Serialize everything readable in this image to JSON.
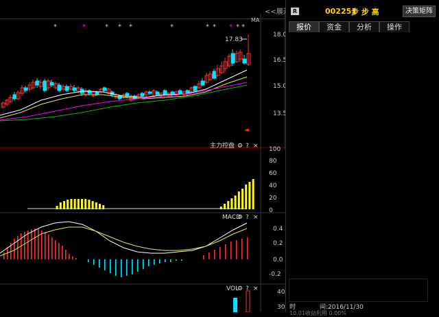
{
  "toolbar": {
    "expand_label": "展开",
    "expand_glyph": "<<",
    "decision_label": "决策矩阵"
  },
  "stock": {
    "badge": "R",
    "code": "002251",
    "name": "步 步 高"
  },
  "tabs": [
    {
      "label": "报价",
      "active": true
    },
    {
      "label": "资金",
      "active": false
    },
    {
      "label": "分析",
      "active": false
    },
    {
      "label": "操作",
      "active": false
    }
  ],
  "main_chart": {
    "label": "MA",
    "high_marker": "17.83",
    "star_marks": [
      "*",
      "*",
      "*",
      "*",
      "*",
      "*",
      "*",
      "*",
      "*",
      "*",
      "*"
    ],
    "price_axis": [
      "18.0",
      "16.5",
      "15.0",
      "13.5"
    ]
  },
  "panels": {
    "zhuli": {
      "title": "主力控盘",
      "gear": "⚙",
      "help": "?",
      "close": "×",
      "axis": [
        "100",
        "80",
        "60",
        "40",
        "20",
        "0"
      ]
    },
    "macd": {
      "title": "MACD",
      "gear": "⚙",
      "help": "?",
      "close": "×",
      "axis": [
        "0.4",
        "0.2",
        "0.0",
        "-0.2"
      ]
    },
    "vol": {
      "title": "VOL",
      "gear": "⚙",
      "help": "?",
      "close": "×",
      "axis": [
        "40",
        "30"
      ]
    }
  },
  "info": {
    "time_label": "时",
    "time_value": "间:2016/11/30",
    "cut_text": "10.01收益利用 0.00%"
  },
  "colors": {
    "up": "#ff3232",
    "down": "#00e5ff",
    "ma_white": "#ffffff",
    "ma_yellow": "#e8e84a",
    "ma_magenta": "#ff00ff",
    "ma_green": "#00c000",
    "volume_profile": "#a01818",
    "profile_cyan": "#008b8b",
    "profile_pink": "#ff7ec8",
    "zhuli_bar": "#ffff00"
  }
}
